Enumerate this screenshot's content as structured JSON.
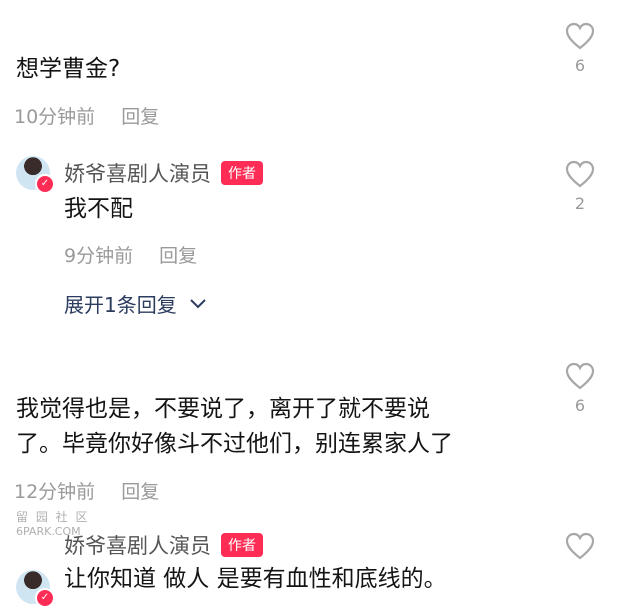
{
  "comments": [
    {
      "text": "想学曹金?",
      "time": "10分钟前",
      "reply_label": "回复",
      "likes": "6"
    },
    {
      "author": "娇爷喜剧人演员",
      "author_tag": "作者",
      "text": "我不配",
      "time": "9分钟前",
      "reply_label": "回复",
      "likes": "2",
      "expand_label": "展开1条回复"
    },
    {
      "text_line1": "我觉得也是，不要说了，离开了就不要说",
      "text_line2": "了。毕竟你好像斗不过他们，别连累家人了",
      "time": "12分钟前",
      "reply_label": "回复",
      "likes": "6"
    },
    {
      "author": "娇爷喜剧人演员",
      "author_tag": "作者",
      "text": "让你知道 做人 是要有血性和底线的。"
    }
  ],
  "watermark": {
    "line1": "留 园 社 区",
    "line2": "6PARK.COM"
  },
  "icons": {
    "like": "heart-outline-icon",
    "verified": "verified-badge-icon",
    "expand": "chevron-down-icon"
  },
  "colors": {
    "author_tag_bg": "#ff2c55",
    "meta_text": "#9a9a9a",
    "expand_text": "#2b3c5e"
  }
}
